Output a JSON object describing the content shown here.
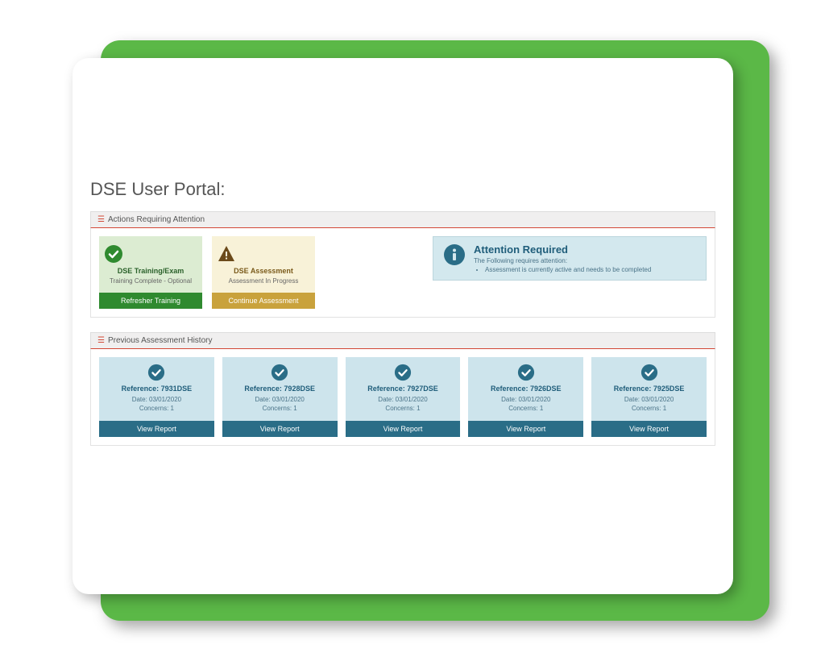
{
  "page_title": "DSE User Portal:",
  "sections": {
    "actions": {
      "header": "Actions Requiring Attention",
      "training_card": {
        "title": "DSE Training/Exam",
        "subtitle": "Training Complete - Optional",
        "button": "Refresher Training"
      },
      "assessment_card": {
        "title": "DSE Assessment",
        "subtitle": "Assessment In Progress",
        "button": "Continue Assessment"
      },
      "attention": {
        "title": "Attention Required",
        "subtitle": "The Following requires attention:",
        "item": "Assessment is currently active and needs to be completed"
      }
    },
    "history": {
      "header": "Previous Assessment History",
      "cards": [
        {
          "ref": "Reference: 7931DSE",
          "date": "Date: 03/01/2020",
          "concerns": "Concerns: 1",
          "button": "View Report"
        },
        {
          "ref": "Reference: 7928DSE",
          "date": "Date: 03/01/2020",
          "concerns": "Concerns: 1",
          "button": "View Report"
        },
        {
          "ref": "Reference: 7927DSE",
          "date": "Date: 03/01/2020",
          "concerns": "Concerns: 1",
          "button": "View Report"
        },
        {
          "ref": "Reference: 7926DSE",
          "date": "Date: 03/01/2020",
          "concerns": "Concerns: 1",
          "button": "View Report"
        },
        {
          "ref": "Reference: 7925DSE",
          "date": "Date: 03/01/2020",
          "concerns": "Concerns: 1",
          "button": "View Report"
        }
      ]
    }
  }
}
